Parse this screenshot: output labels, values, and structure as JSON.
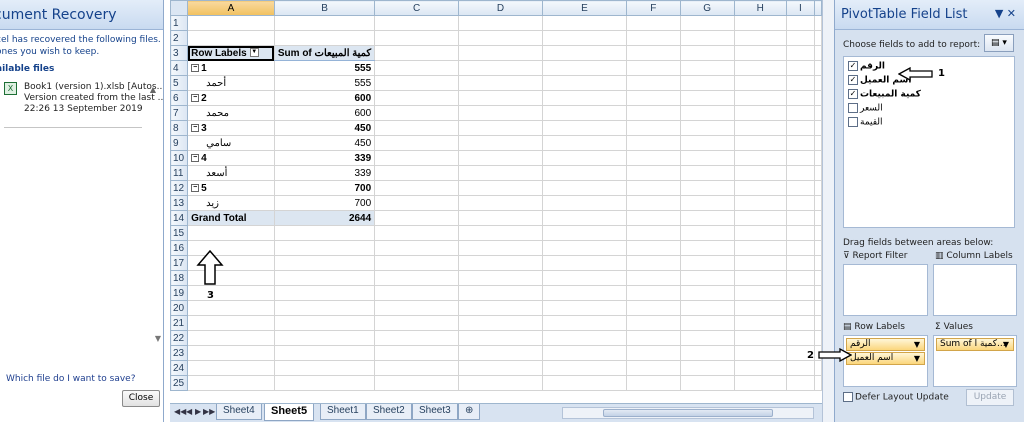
{
  "recovery": {
    "title": "cument Recovery",
    "message_line1": "cel has recovered the following files.  Save",
    "message_line2": " ones you wish to keep.",
    "available_label": "ailable files",
    "file": {
      "name": "Book1 (version 1).xlsb  [Autos...",
      "desc": "Version created from the last ...",
      "time": "22:26 13 September 2019"
    },
    "help_link": "Which file do I want to save?",
    "close_label": "Close"
  },
  "grid": {
    "columns": [
      "A",
      "B",
      "C",
      "D",
      "E",
      "F",
      "G",
      "H",
      "I"
    ],
    "selected_column": "A",
    "rows": [
      "1",
      "2",
      "3",
      "4",
      "5",
      "6",
      "7",
      "8",
      "9",
      "10",
      "11",
      "12",
      "13",
      "14",
      "15",
      "16",
      "17",
      "18",
      "19",
      "20",
      "21",
      "22",
      "23",
      "24",
      "25"
    ],
    "pivot": {
      "row_labels_header": "Row Labels",
      "values_header": "Sum of كمية المبيعات",
      "rows": [
        {
          "label": "1",
          "value": "555",
          "group": true
        },
        {
          "label": "أحمد",
          "value": "555",
          "group": false
        },
        {
          "label": "2",
          "value": "600",
          "group": true
        },
        {
          "label": "محمد",
          "value": "600",
          "group": false
        },
        {
          "label": "3",
          "value": "450",
          "group": true
        },
        {
          "label": "سامي",
          "value": "450",
          "group": false
        },
        {
          "label": "4",
          "value": "339",
          "group": true
        },
        {
          "label": "أسعد",
          "value": "339",
          "group": false
        },
        {
          "label": "5",
          "value": "700",
          "group": true
        },
        {
          "label": "زيد",
          "value": "700",
          "group": false
        }
      ],
      "grand_total_label": "Grand Total",
      "grand_total_value": "2644"
    }
  },
  "tabs": {
    "items": [
      "Sheet4",
      "Sheet5",
      "Sheet1",
      "Sheet2",
      "Sheet3"
    ],
    "active": "Sheet5"
  },
  "pivot_pane": {
    "title": "PivotTable Field List",
    "choose_label": "Choose fields to add to report:",
    "fields": [
      {
        "name": "الرقم",
        "checked": true
      },
      {
        "name": "اسم العميل",
        "checked": true
      },
      {
        "name": "كمية المبيعات",
        "checked": true
      },
      {
        "name": "السعر",
        "checked": false
      },
      {
        "name": "القيمة",
        "checked": false
      }
    ],
    "drag_label": "Drag fields between areas below:",
    "report_filter_label": "Report Filter",
    "column_labels_label": "Column Labels",
    "row_labels_label": "Row Labels",
    "values_label": "Values",
    "row_chips": [
      "الرقم",
      "اسم العميل"
    ],
    "value_chips": [
      "Sum of كمية ا..."
    ],
    "defer_label": "Defer Layout Update",
    "update_label": "Update"
  },
  "annotations": {
    "n1": "1",
    "n2": "2",
    "n3": "3"
  }
}
